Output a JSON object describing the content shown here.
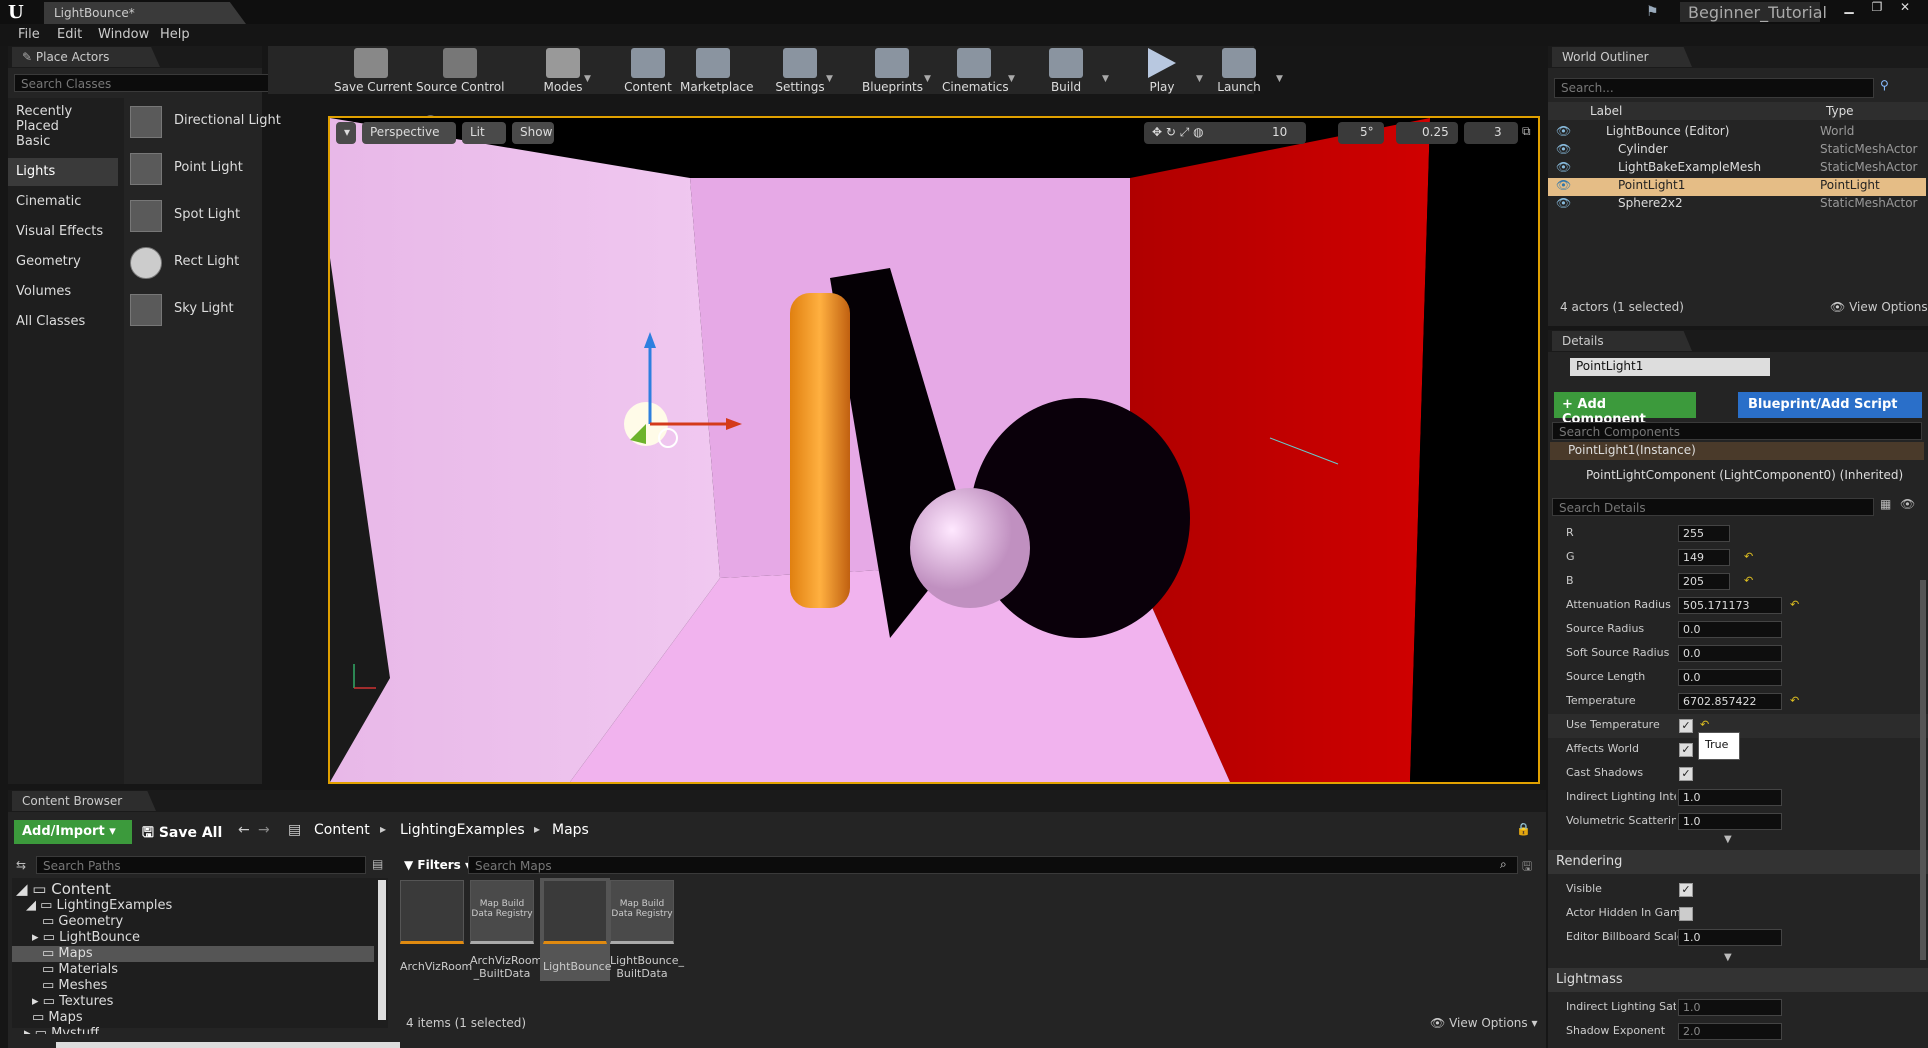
{
  "titlebar": {
    "doc_tab": "LightBounce*",
    "project": "Beginner_Tutorial"
  },
  "menu": [
    "File",
    "Edit",
    "Window",
    "Help"
  ],
  "place_actors": {
    "tab": "Place Actors",
    "search_placeholder": "Search Classes",
    "categories": [
      "Recently Placed",
      "Basic",
      "Lights",
      "Cinematic",
      "Visual Effects",
      "Geometry",
      "Volumes",
      "All Classes"
    ],
    "selected_category": "Lights",
    "items": [
      "Directional Light",
      "Point Light",
      "Spot Light",
      "Rect Light",
      "Sky Light"
    ]
  },
  "toolbar": [
    "Save Current",
    "Source Control",
    "Modes",
    "Content",
    "Marketplace",
    "Settings",
    "Blueprints",
    "Cinematics",
    "Build",
    "Play",
    "Launch"
  ],
  "viewport": {
    "perspective": "Perspective",
    "lit": "Lit",
    "show": "Show",
    "grid_snap": "10",
    "angle_snap": "5°",
    "scale_snap": "0.25",
    "camera_speed": "3"
  },
  "outliner": {
    "tab": "World Outliner",
    "search_placeholder": "Search...",
    "col_label": "Label",
    "col_type": "Type",
    "rows": [
      {
        "label": "LightBounce (Editor)",
        "type": "World"
      },
      {
        "label": "Cylinder",
        "type": "StaticMeshActor"
      },
      {
        "label": "LightBakeExampleMesh",
        "type": "StaticMeshActor"
      },
      {
        "label": "PointLight1",
        "type": "PointLight"
      },
      {
        "label": "Sphere2x2",
        "type": "StaticMeshActor"
      }
    ],
    "status": "4 actors (1 selected)",
    "view_options": "View Options"
  },
  "details": {
    "tab": "Details",
    "name": "PointLight1",
    "add_component": "+ Add Component",
    "blueprint": "Blueprint/Add Script",
    "search_components": "Search Components",
    "instance": "PointLight1(Instance)",
    "component": "PointLightComponent (LightComponent0) (Inherited)",
    "search_details": "Search Details",
    "props": [
      {
        "label": "R",
        "value": "255"
      },
      {
        "label": "G",
        "value": "149"
      },
      {
        "label": "B",
        "value": "205"
      },
      {
        "label": "Attenuation Radius",
        "value": "505.171173"
      },
      {
        "label": "Source Radius",
        "value": "0.0"
      },
      {
        "label": "Soft Source Radius",
        "value": "0.0"
      },
      {
        "label": "Source Length",
        "value": "0.0"
      },
      {
        "label": "Temperature",
        "value": "6702.857422"
      }
    ],
    "checks": [
      {
        "label": "Use Temperature"
      },
      {
        "label": "Affects World"
      },
      {
        "label": "Cast Shadows"
      }
    ],
    "tooltip": "True",
    "props2": [
      {
        "label": "Indirect Lighting Inten",
        "value": "1.0"
      },
      {
        "label": "Volumetric Scattering",
        "value": "1.0"
      }
    ],
    "rendering": "Rendering",
    "visible": "Visible",
    "actor_hidden": "Actor Hidden In Game",
    "billboard": "Editor Billboard Scale",
    "billboard_value": "1.0",
    "lightmass": "Lightmass",
    "indirect_sat": "Indirect Lighting Satur",
    "indirect_sat_value": "1.0",
    "shadow_exp": "Shadow Exponent",
    "shadow_exp_value": "2.0"
  },
  "content_browser": {
    "tab": "Content Browser",
    "add_import": "Add/Import",
    "save_all": "Save All",
    "path": [
      "Content",
      "LightingExamples",
      "Maps"
    ],
    "search_paths": "Search Paths",
    "filters": "Filters",
    "search_maps": "Search Maps",
    "tree": [
      "Content",
      "LightingExamples",
      "Geometry",
      "LightBounce",
      "Maps",
      "Materials",
      "Meshes",
      "Textures",
      "Maps",
      "Mystuff"
    ],
    "assets": [
      {
        "name": "ArchVizRoom",
        "thumb": ""
      },
      {
        "name": "ArchVizRoom _BuiltData",
        "thumb": "Map Build Data Registry"
      },
      {
        "name": "LightBounce",
        "thumb": ""
      },
      {
        "name": "LightBounce_ BuiltData",
        "thumb": "Map Build Data Registry"
      }
    ],
    "status": "4 items (1 selected)",
    "view_options": "View Options"
  },
  "colors": {
    "accent_green": "#3c9a3c",
    "accent_blue": "#2a6fc9",
    "selection": "#e5bd86",
    "viewport_border": "#e0a000"
  }
}
